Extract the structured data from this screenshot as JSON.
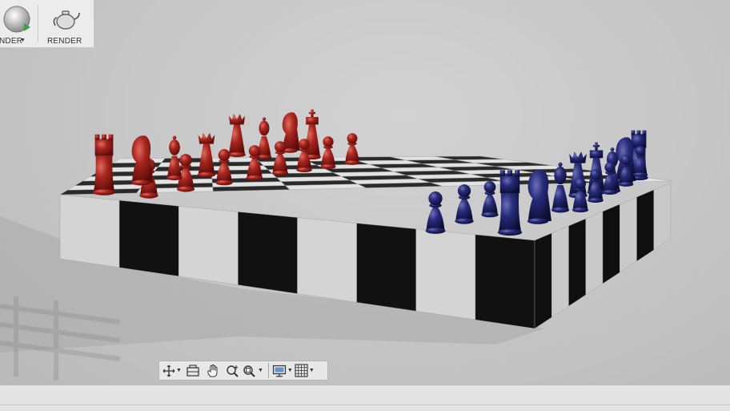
{
  "toolbar": {
    "render_dropdown_label": "NDER",
    "render_label": "RENDER"
  },
  "navbar": {
    "buttons": [
      {
        "icon": "orbit-icon",
        "has_dropdown": true
      },
      {
        "icon": "look-at-icon",
        "has_dropdown": false
      },
      {
        "icon": "pan-icon",
        "has_dropdown": false
      },
      {
        "icon": "zoom-icon",
        "has_dropdown": false
      },
      {
        "icon": "fit-zoom-icon",
        "has_dropdown": true
      },
      {
        "icon": "display-settings-icon",
        "has_dropdown": true
      },
      {
        "icon": "grid-settings-icon",
        "has_dropdown": true
      }
    ]
  },
  "scene": {
    "subject": "chess set",
    "red_pieces_color": "#8e1d1a",
    "blue_pieces_color": "#1c1f5a",
    "board_light": "#d7d7d7",
    "board_dark": "#151515"
  }
}
